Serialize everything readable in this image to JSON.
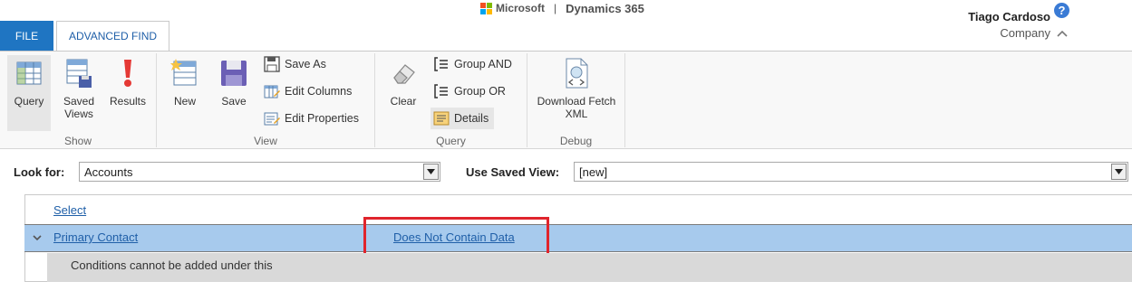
{
  "header": {
    "brand_microsoft": "Microsoft",
    "brand_separator": "|",
    "brand_product": "Dynamics 365",
    "user_name": "Tiago Cardoso",
    "user_company": "Company",
    "help_icon": "?"
  },
  "tabs": [
    {
      "label": "FILE"
    },
    {
      "label": "ADVANCED FIND"
    }
  ],
  "ribbon": {
    "show": {
      "label": "Show",
      "query": "Query",
      "saved_views": "Saved Views",
      "results": "Results"
    },
    "view": {
      "label": "View",
      "new": "New",
      "save": "Save",
      "save_as": "Save As",
      "edit_columns": "Edit Columns",
      "edit_properties": "Edit Properties"
    },
    "query": {
      "label": "Query",
      "clear": "Clear",
      "group_and": "Group AND",
      "group_or": "Group OR",
      "details": "Details"
    },
    "debug": {
      "label": "Debug",
      "download_fetch_xml": "Download Fetch XML"
    }
  },
  "lookfor": {
    "label": "Look for:",
    "value": "Accounts"
  },
  "saved_view": {
    "label": "Use Saved View:",
    "value": "[new]"
  },
  "grid": {
    "select_link": "Select",
    "condition": {
      "field": "Primary Contact",
      "operator": "Does Not Contain Data"
    },
    "message": "Conditions cannot be added under this"
  },
  "colors": {
    "file_tab": "#1f75c2",
    "selected_row": "#a7caed",
    "highlight": "#e0242c",
    "link": "#1f5fa8"
  }
}
